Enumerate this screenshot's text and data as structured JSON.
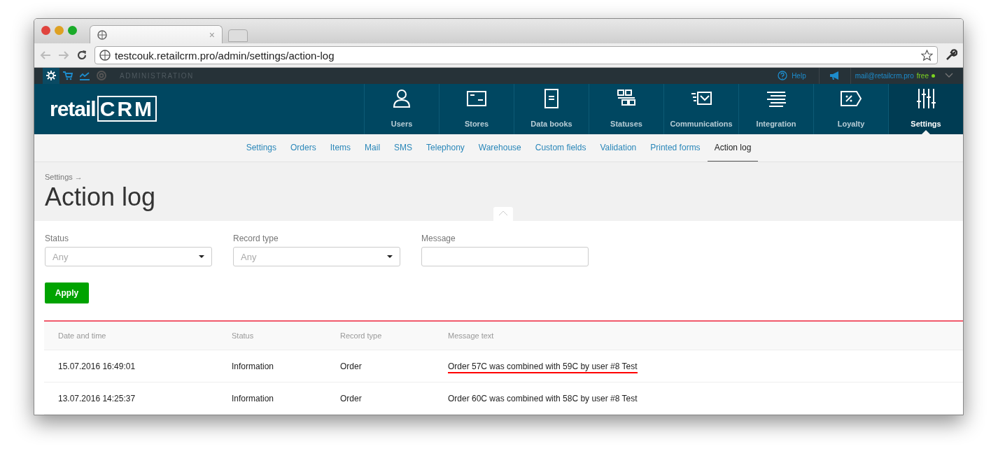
{
  "browser": {
    "tab": {
      "close": "×"
    },
    "url": "testcouk.retailcrm.pro/admin/settings/action-log"
  },
  "topbar": {
    "apps": [
      {
        "kind": "gear",
        "selected": true
      },
      {
        "kind": "cart",
        "selected": false
      },
      {
        "kind": "chart",
        "selected": false
      },
      {
        "kind": "target",
        "selected": false
      }
    ],
    "section": "ADMINISTRATION",
    "help": "Help",
    "email": "mail@retailcrm.pro",
    "plan": "free",
    "online": true
  },
  "logo": {
    "text": "retail",
    "mark": "CRM"
  },
  "nav": [
    {
      "label": "Users",
      "selected": false
    },
    {
      "label": "Stores",
      "selected": false
    },
    {
      "label": "Data books",
      "selected": false
    },
    {
      "label": "Statuses",
      "selected": false
    },
    {
      "label": "Communications",
      "selected": false
    },
    {
      "label": "Integration",
      "selected": false
    },
    {
      "label": "Loyalty",
      "selected": false
    },
    {
      "label": "Settings",
      "selected": true
    }
  ],
  "subnav": [
    {
      "label": "Settings",
      "selected": false
    },
    {
      "label": "Orders",
      "selected": false
    },
    {
      "label": "Items",
      "selected": false
    },
    {
      "label": "Mail",
      "selected": false
    },
    {
      "label": "SMS",
      "selected": false
    },
    {
      "label": "Telephony",
      "selected": false
    },
    {
      "label": "Warehouse",
      "selected": false
    },
    {
      "label": "Custom fields",
      "selected": false
    },
    {
      "label": "Validation",
      "selected": false
    },
    {
      "label": "Printed forms",
      "selected": false
    },
    {
      "label": "Action log",
      "selected": true
    }
  ],
  "breadcrumb": "Settings →",
  "title": "Action log",
  "filters": [
    {
      "label": "Status",
      "kind": "select",
      "placeholder": "Any"
    },
    {
      "label": "Record type",
      "kind": "select",
      "placeholder": "Any"
    },
    {
      "label": "Message",
      "kind": "text"
    }
  ],
  "apply": "Apply",
  "table": {
    "columns": [
      "Date and time",
      "Status",
      "Record type",
      "Message text"
    ],
    "rows": [
      {
        "cells": [
          "15.07.2016 16:49:01",
          "Information",
          "Order",
          "Order 57C was combined with 59C by user #8 Test"
        ],
        "underlined": true
      },
      {
        "cells": [
          "13.07.2016 14:25:37",
          "Information",
          "Order",
          "Order 60C was combined with 58C by user #8 Test"
        ],
        "underlined": false
      }
    ]
  }
}
